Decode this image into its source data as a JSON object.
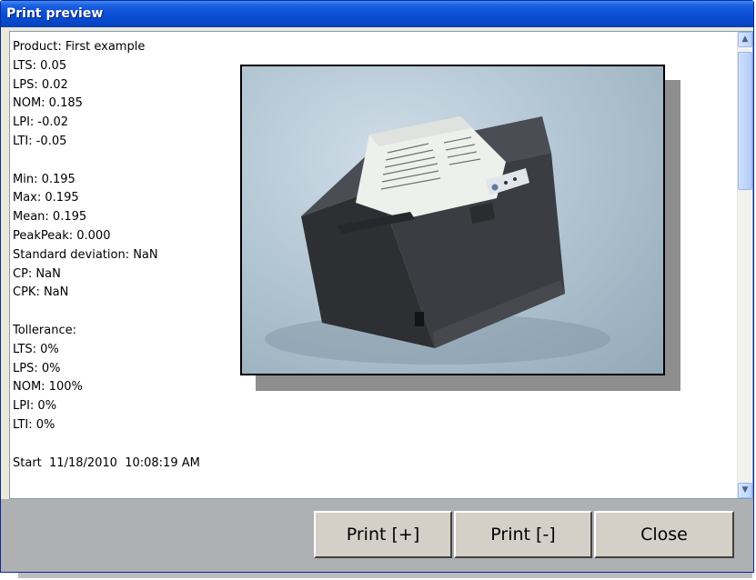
{
  "window": {
    "title": "Print preview"
  },
  "report": {
    "lines": [
      "Product: First example",
      "LTS: 0.05",
      "LPS: 0.02",
      "NOM: 0.185",
      "LPI: -0.02",
      "LTI: -0.05",
      "",
      "Min: 0.195",
      "Max: 0.195",
      "Mean: 0.195",
      "PeakPeak: 0.000",
      "Standard deviation: NaN",
      "CP: NaN",
      "CPK: NaN",
      "",
      "Tollerance:",
      "LTS: 0%",
      "LPS: 0%",
      "NOM: 100%",
      "LPI: 0%",
      "LTI: 0%",
      "",
      "Start  11/18/2010  10:08:19 AM"
    ],
    "image_subject": "receipt-printer-photo"
  },
  "buttons": {
    "print_plus": "Print [+]",
    "print_minus": "Print [-]",
    "close": "Close"
  },
  "icons": {
    "scroll_up": "scroll-up-arrow-icon",
    "scroll_down": "scroll-down-arrow-icon"
  },
  "colors": {
    "titlebar": "#0a4ed8",
    "button_bar": "#aeb0b2",
    "button_face": "#d4d0c8"
  }
}
